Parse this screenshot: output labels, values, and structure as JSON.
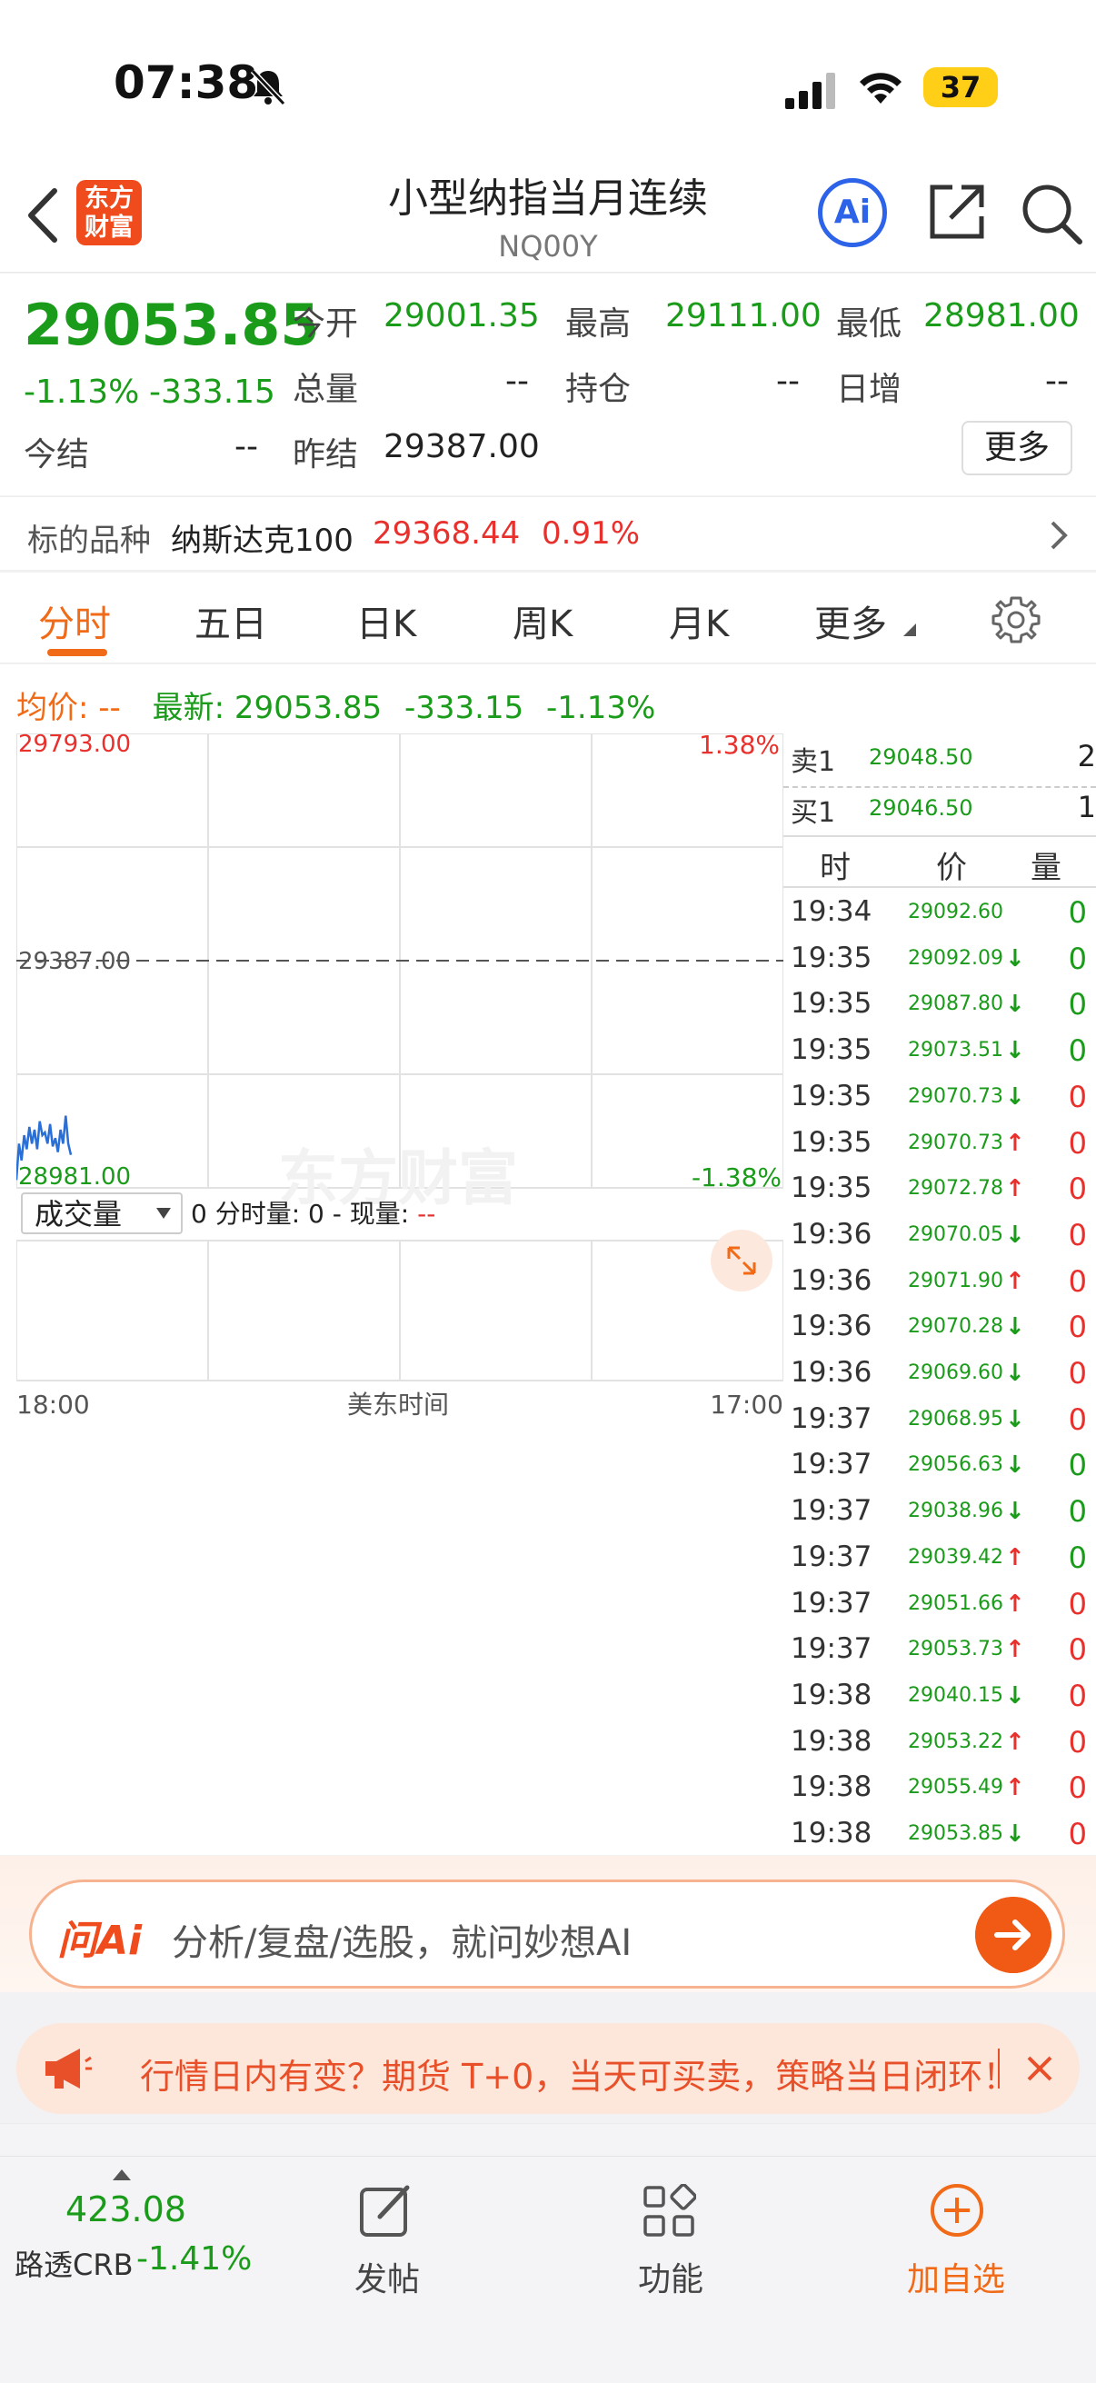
{
  "status_bar": {
    "time": "07:38",
    "battery": "37"
  },
  "header": {
    "logo_line1": "东方",
    "logo_line2": "财富",
    "title": "小型纳指当月连续",
    "code": "NQ00Y",
    "ai_label": "Ai"
  },
  "quote": {
    "price": "29053.85",
    "change_pct": "-1.13%",
    "change_abs": "-333.15",
    "open_label": "今开",
    "open_value": "29001.35",
    "high_label": "最高",
    "high_value": "29111.00",
    "low_label": "最低",
    "low_value": "28981.00",
    "volume_label": "总量",
    "volume_value": "--",
    "position_label": "持仓",
    "position_value": "--",
    "daily_inc_label": "日增",
    "daily_inc_value": "--",
    "settle_label": "今结",
    "settle_value": "--",
    "prev_settle_label": "昨结",
    "prev_settle_value": "29387.00",
    "more_button": "更多"
  },
  "underlying": {
    "label": "标的品种",
    "name": "纳斯达克100",
    "price": "29368.44",
    "change": "0.91%"
  },
  "tabs": [
    {
      "label": "分时",
      "active": true
    },
    {
      "label": "五日",
      "active": false
    },
    {
      "label": "日K",
      "active": false
    },
    {
      "label": "周K",
      "active": false
    },
    {
      "label": "月K",
      "active": false
    },
    {
      "label": "更多",
      "active": false
    }
  ],
  "info_line": {
    "avg_label": "均价:",
    "avg_value": "--",
    "latest_label": "最新:",
    "latest_value": "29053.85",
    "latest_change": "-333.15",
    "latest_pct": "-1.13%"
  },
  "chart_data": {
    "type": "line",
    "title": "",
    "y_max_label": "29793.00",
    "y_min_label": "28981.00",
    "y_mid_label": "29387.00",
    "pct_max_label": "1.38%",
    "pct_min_label": "-1.38%",
    "ylim": [
      28981.0,
      29793.0
    ],
    "reference_price": 29387.0,
    "x_start_label": "18:00",
    "x_mid_label": "美东时间",
    "x_end_label": "17:00",
    "watermark": "东方财富",
    "series": [
      {
        "values": [
          28995,
          29060,
          29030,
          29075,
          29050,
          29090,
          29060,
          29085,
          29050,
          29100,
          29075,
          29080,
          29060,
          29095,
          29055,
          29070,
          29045,
          29085,
          29060,
          29110,
          29060,
          29040
        ]
      }
    ],
    "grid": true
  },
  "volume_panel": {
    "selector_label": "成交量",
    "info_prefix": "0 分时量: 0 - 现量:",
    "info_value": "--"
  },
  "order_book": {
    "sell_label": "卖1",
    "sell_price": "29048.50",
    "sell_qty": "2",
    "buy_label": "买1",
    "buy_price": "29046.50",
    "buy_qty": "1",
    "col_time": "时",
    "col_price": "价",
    "col_qty": "量"
  },
  "trades": [
    {
      "time": "19:34",
      "price": "29092.60",
      "dir": "",
      "qty": "0",
      "qty_color": "green"
    },
    {
      "time": "19:35",
      "price": "29092.09",
      "dir": "down",
      "qty": "0",
      "qty_color": "green"
    },
    {
      "time": "19:35",
      "price": "29087.80",
      "dir": "down",
      "qty": "0",
      "qty_color": "green"
    },
    {
      "time": "19:35",
      "price": "29073.51",
      "dir": "down",
      "qty": "0",
      "qty_color": "green"
    },
    {
      "time": "19:35",
      "price": "29070.73",
      "dir": "down",
      "qty": "0",
      "qty_color": "red"
    },
    {
      "time": "19:35",
      "price": "29070.73",
      "dir": "up",
      "qty": "0",
      "qty_color": "red"
    },
    {
      "time": "19:35",
      "price": "29072.78",
      "dir": "up",
      "qty": "0",
      "qty_color": "red"
    },
    {
      "time": "19:36",
      "price": "29070.05",
      "dir": "down",
      "qty": "0",
      "qty_color": "red"
    },
    {
      "time": "19:36",
      "price": "29071.90",
      "dir": "up",
      "qty": "0",
      "qty_color": "red"
    },
    {
      "time": "19:36",
      "price": "29070.28",
      "dir": "down",
      "qty": "0",
      "qty_color": "red"
    },
    {
      "time": "19:36",
      "price": "29069.60",
      "dir": "down",
      "qty": "0",
      "qty_color": "red"
    },
    {
      "time": "19:37",
      "price": "29068.95",
      "dir": "down",
      "qty": "0",
      "qty_color": "red"
    },
    {
      "time": "19:37",
      "price": "29056.63",
      "dir": "down",
      "qty": "0",
      "qty_color": "green"
    },
    {
      "time": "19:37",
      "price": "29038.96",
      "dir": "down",
      "qty": "0",
      "qty_color": "green"
    },
    {
      "time": "19:37",
      "price": "29039.42",
      "dir": "up",
      "qty": "0",
      "qty_color": "green"
    },
    {
      "time": "19:37",
      "price": "29051.66",
      "dir": "up",
      "qty": "0",
      "qty_color": "red"
    },
    {
      "time": "19:37",
      "price": "29053.73",
      "dir": "up",
      "qty": "0",
      "qty_color": "red"
    },
    {
      "time": "19:38",
      "price": "29040.15",
      "dir": "down",
      "qty": "0",
      "qty_color": "red"
    },
    {
      "time": "19:38",
      "price": "29053.22",
      "dir": "up",
      "qty": "0",
      "qty_color": "red"
    },
    {
      "time": "19:38",
      "price": "29055.49",
      "dir": "up",
      "qty": "0",
      "qty_color": "red"
    },
    {
      "time": "19:38",
      "price": "29053.85",
      "dir": "down",
      "qty": "0",
      "qty_color": "red"
    }
  ],
  "ai_bar": {
    "logo": "问Ai",
    "placeholder": "分析/复盘/选股，就问妙想AI"
  },
  "notice": {
    "text": "行情日内有变？期货 T+0，当天可买卖，策略当日闭环！"
  },
  "bottom_bar": {
    "index_value": "423.08",
    "index_name": "路透CRB",
    "index_change": "-1.41%",
    "post_label": "发帖",
    "func_label": "功能",
    "add_label": "加自选"
  },
  "colors": {
    "accent": "#f06a17",
    "up": "#e8302c",
    "down": "#1a9b1a",
    "line": "#2a6fd6"
  }
}
